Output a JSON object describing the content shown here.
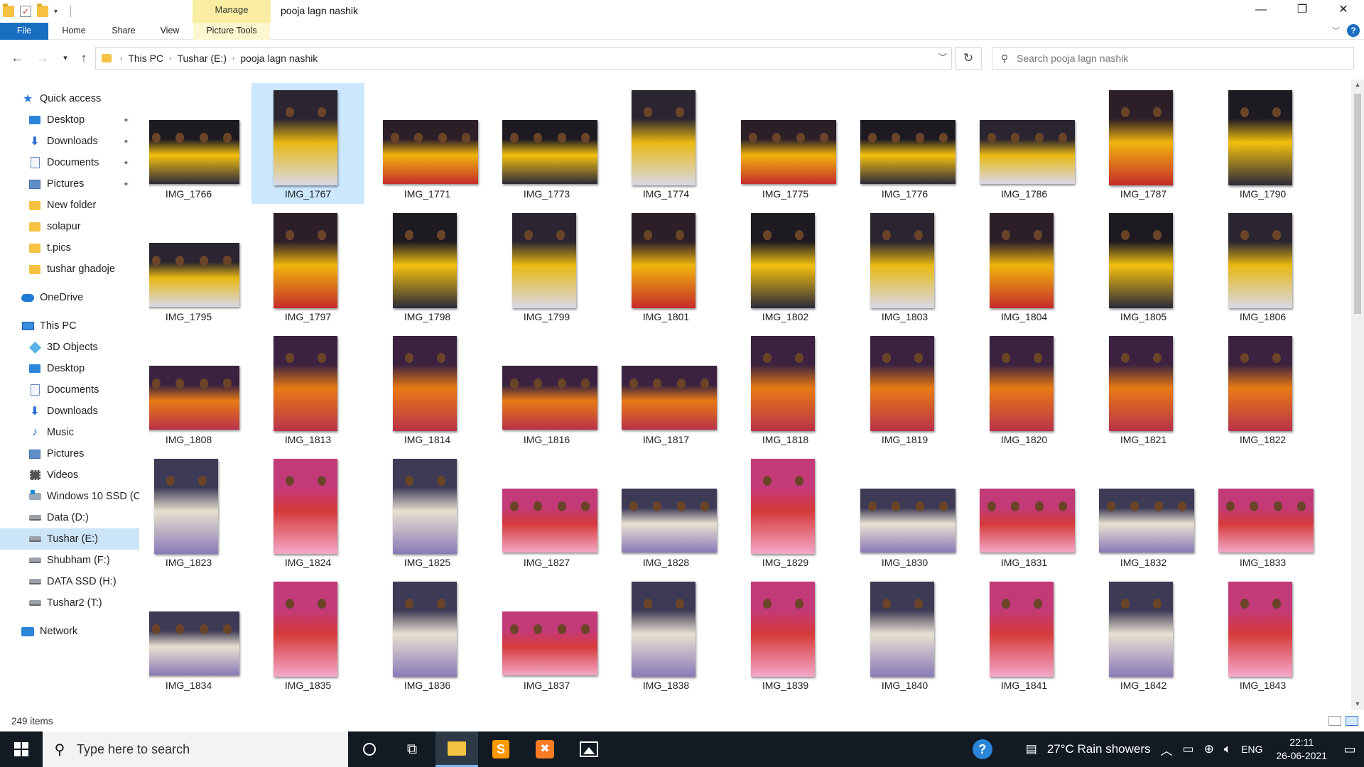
{
  "window": {
    "title": "pooja lagn nashik",
    "contextual_tab": "Manage",
    "minimize_glyph": "—",
    "maximize_glyph": "❐",
    "close_glyph": "✕"
  },
  "ribbon": {
    "tabs": [
      "File",
      "Home",
      "Share",
      "View",
      "Picture Tools"
    ]
  },
  "address": {
    "crumbs": [
      "This PC",
      "Tushar (E:)",
      "pooja lagn nashik"
    ]
  },
  "search": {
    "placeholder": "Search pooja lagn nashik"
  },
  "nav": {
    "quick_access": "Quick access",
    "quick_items": [
      "Desktop",
      "Downloads",
      "Documents",
      "Pictures",
      "New folder",
      "solapur",
      "t.pics",
      "tushar ghadoje"
    ],
    "onedrive": "OneDrive",
    "this_pc": "This PC",
    "pc_items": [
      "3D Objects",
      "Desktop",
      "Documents",
      "Downloads",
      "Music",
      "Pictures",
      "Videos",
      "Windows 10 SSD (C",
      "Data (D:)",
      "Tushar (E:)",
      "Shubham (F:)",
      "DATA SSD (H:)",
      "Tushar2 (T:)"
    ],
    "network": "Network"
  },
  "files": [
    {
      "name": "IMG_1766",
      "o": "l"
    },
    {
      "name": "IMG_1767",
      "o": "p"
    },
    {
      "name": "IMG_1771",
      "o": "l"
    },
    {
      "name": "IMG_1773",
      "o": "l"
    },
    {
      "name": "IMG_1774",
      "o": "p"
    },
    {
      "name": "IMG_1775",
      "o": "l"
    },
    {
      "name": "IMG_1776",
      "o": "l"
    },
    {
      "name": "IMG_1786",
      "o": "l"
    },
    {
      "name": "IMG_1787",
      "o": "p"
    },
    {
      "name": "IMG_1790",
      "o": "p"
    },
    {
      "name": "IMG_1795",
      "o": "l"
    },
    {
      "name": "IMG_1797",
      "o": "p"
    },
    {
      "name": "IMG_1798",
      "o": "p"
    },
    {
      "name": "IMG_1799",
      "o": "p"
    },
    {
      "name": "IMG_1801",
      "o": "p"
    },
    {
      "name": "IMG_1802",
      "o": "p"
    },
    {
      "name": "IMG_1803",
      "o": "p"
    },
    {
      "name": "IMG_1804",
      "o": "p"
    },
    {
      "name": "IMG_1805",
      "o": "p"
    },
    {
      "name": "IMG_1806",
      "o": "p"
    },
    {
      "name": "IMG_1808",
      "o": "l"
    },
    {
      "name": "IMG_1813",
      "o": "p"
    },
    {
      "name": "IMG_1814",
      "o": "p"
    },
    {
      "name": "IMG_1816",
      "o": "l"
    },
    {
      "name": "IMG_1817",
      "o": "l"
    },
    {
      "name": "IMG_1818",
      "o": "p"
    },
    {
      "name": "IMG_1819",
      "o": "p"
    },
    {
      "name": "IMG_1820",
      "o": "p"
    },
    {
      "name": "IMG_1821",
      "o": "p"
    },
    {
      "name": "IMG_1822",
      "o": "p"
    },
    {
      "name": "IMG_1823",
      "o": "p"
    },
    {
      "name": "IMG_1824",
      "o": "p"
    },
    {
      "name": "IMG_1825",
      "o": "p"
    },
    {
      "name": "IMG_1827",
      "o": "l"
    },
    {
      "name": "IMG_1828",
      "o": "l"
    },
    {
      "name": "IMG_1829",
      "o": "p"
    },
    {
      "name": "IMG_1830",
      "o": "l"
    },
    {
      "name": "IMG_1831",
      "o": "l"
    },
    {
      "name": "IMG_1832",
      "o": "l"
    },
    {
      "name": "IMG_1833",
      "o": "l"
    },
    {
      "name": "IMG_1834",
      "o": "l"
    },
    {
      "name": "IMG_1835",
      "o": "p"
    },
    {
      "name": "IMG_1836",
      "o": "p"
    },
    {
      "name": "IMG_1837",
      "o": "l"
    },
    {
      "name": "IMG_1838",
      "o": "p"
    },
    {
      "name": "IMG_1839",
      "o": "p"
    },
    {
      "name": "IMG_1840",
      "o": "p"
    },
    {
      "name": "IMG_1841",
      "o": "p"
    },
    {
      "name": "IMG_1842",
      "o": "p"
    },
    {
      "name": "IMG_1843",
      "o": "p"
    }
  ],
  "selected_file": "IMG_1767",
  "status": {
    "item_count": "249 items"
  },
  "taskbar": {
    "search_placeholder": "Type here to search",
    "weather": "27°C  Rain showers",
    "language": "ENG",
    "time": "22:11",
    "date": "26-06-2021"
  },
  "colors": {
    "file_tab": "#1a6ec1",
    "manage_tab": "#f8eda3",
    "selection": "#cce8ff",
    "taskbar": "#121a24"
  }
}
